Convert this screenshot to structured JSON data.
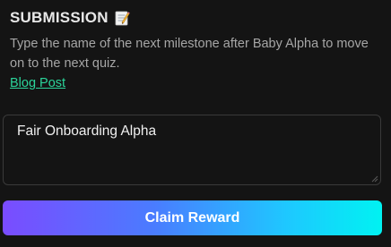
{
  "submission": {
    "title": "SUBMISSION",
    "title_icon": "memo-icon",
    "description": "Type the name of the next milestone after Baby Alpha to move on to the next quiz.",
    "link_label": "Blog Post",
    "answer_value": "Fair Onboarding Alpha",
    "button_label": "Claim Reward"
  },
  "colors": {
    "background": "#141414",
    "link": "#2bd49a",
    "button_gradient_start": "#7a4cff",
    "button_gradient_end": "#00f2f2"
  }
}
